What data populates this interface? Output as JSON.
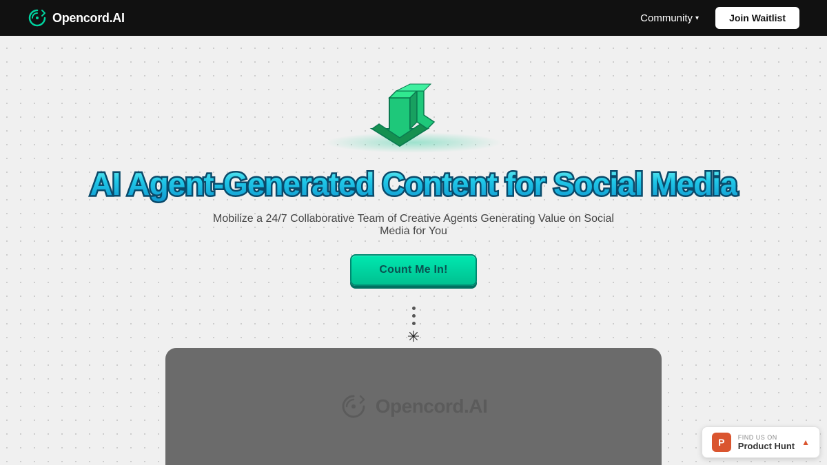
{
  "navbar": {
    "logo_text": "Opencord.AI",
    "community_label": "Community",
    "community_chevron": "▾",
    "join_waitlist_label": "Join Waitlist"
  },
  "hero": {
    "heading": "AI Agent-Generated Content for Social Media",
    "subtext": "Mobilize a 24/7 Collaborative Team of Creative Agents Generating Value on Social Media for You",
    "cta_label": "Count Me In!"
  },
  "bottom_section": {
    "logo_text": "Opencord.AI"
  },
  "product_hunt": {
    "find_us_label": "FIND US ON",
    "name": "Product Hunt",
    "upvote_arrow": "▲"
  }
}
